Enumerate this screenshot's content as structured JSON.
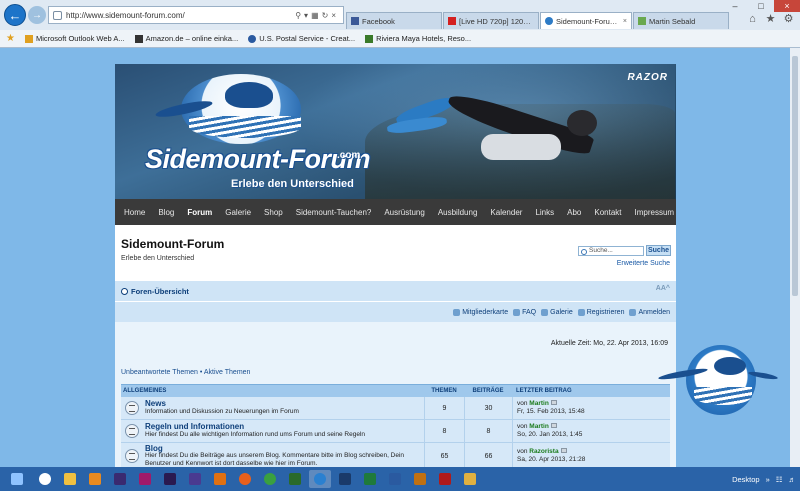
{
  "browser": {
    "address": "http://www.sidemount-forum.com/",
    "tabs": [
      {
        "label": "Facebook",
        "icon": "facebook-icon",
        "color": "#3b5998"
      },
      {
        "label": "[Live HD 720p] 120715 - P...",
        "icon": "youtube-icon",
        "color": "#d42020"
      },
      {
        "label": "Sidemount-Forum • F...",
        "icon": "site-icon",
        "color": "#2d7bc6",
        "active": true
      },
      {
        "label": "Martin Sebald",
        "icon": "page-icon",
        "color": "#6aa84f"
      }
    ],
    "favorites": [
      {
        "label": "Microsoft Outlook Web A...",
        "icon": "outlook-icon",
        "color": "#e0a020"
      },
      {
        "label": "Amazon.de – online einka...",
        "icon": "amazon-icon",
        "color": "#333333"
      },
      {
        "label": "U.S. Postal Service - Creat...",
        "icon": "usps-icon",
        "color": "#2a5aa0"
      },
      {
        "label": "Riviera Maya Hotels, Reso...",
        "icon": "palm-icon",
        "color": "#3a7a2a"
      }
    ]
  },
  "site": {
    "logo_text": "Sidemount-Forum",
    "logo_com": ".com",
    "logo_tagline": "Erlebe den Unterschied",
    "brand_mark": "RAZOR",
    "nav": [
      "Home",
      "Blog",
      "Forum",
      "Galerie",
      "Shop",
      "Sidemount-Tauchen?",
      "Ausrüstung",
      "Ausbildung",
      "Kalender",
      "Links",
      "Abo",
      "Kontakt",
      "Impressum"
    ],
    "nav_active": "Forum",
    "title": "Sidemount-Forum",
    "subtitle": "Erlebe den Unterschied",
    "search_placeholder": "Suche...",
    "search_button": "Suche",
    "advanced_search": "Erweiterte Suche",
    "breadcrumb": "Foren-Übersicht",
    "font_size_ctrl": "AA^",
    "links": [
      "Mitgliederkarte",
      "FAQ",
      "Galerie",
      "Registrieren",
      "Anmelden"
    ],
    "current_time": "Aktuelle Zeit: Mo, 22. Apr 2013, 16:09",
    "quick_links": "Unbeantwortete Themen • Aktive Themen",
    "table": {
      "headers": [
        "ALLGEMEINES",
        "THEMEN",
        "BEITRÄGE",
        "LETZTER BEITRAG"
      ],
      "rows": [
        {
          "name": "News",
          "desc": "Information und Diskussion zu Neuerungen im Forum",
          "topics": "9",
          "posts": "30",
          "last_by": "Martin",
          "last_date": "Fr, 15. Feb 2013, 15:48"
        },
        {
          "name": "Regeln und Informationen",
          "desc": "Hier findest Du alle wichtigen Information rund ums Forum und seine Regeln",
          "topics": "8",
          "posts": "8",
          "last_by": "Martin",
          "last_date": "So, 20. Jan 2013, 1:45"
        },
        {
          "name": "Blog",
          "desc": "Hier findest Du die Beiträge aus unserem Blog. Kommentare bitte im Blog schreiben, Dein Benutzer und Kennwort ist dort dasselbe wie hier im Forum.",
          "topics": "65",
          "posts": "66",
          "last_by": "Razorista",
          "last_date": "Sa, 20. Apr 2013, 21:28"
        }
      ]
    }
  },
  "taskbar": {
    "desktop_label": "Desktop",
    "apps": [
      {
        "name": "start",
        "color": "#2a63a8"
      },
      {
        "name": "hp",
        "color": "#ffffff"
      },
      {
        "name": "explorer",
        "color": "#f0c040"
      },
      {
        "name": "outlook",
        "color": "#e88a20"
      },
      {
        "name": "premiere",
        "color": "#3a2a70"
      },
      {
        "name": "indesign",
        "color": "#a01a6a"
      },
      {
        "name": "after-effects",
        "color": "#2a1a50"
      },
      {
        "name": "premiere-2",
        "color": "#4a3a90"
      },
      {
        "name": "vlc",
        "color": "#e07010"
      },
      {
        "name": "firefox",
        "color": "#e8601c"
      },
      {
        "name": "chrome",
        "color": "#3aa040"
      },
      {
        "name": "dreamweaver",
        "color": "#2a6a2a"
      },
      {
        "name": "ie",
        "color": "#2a80d0"
      },
      {
        "name": "photoshop",
        "color": "#1a3a6a"
      },
      {
        "name": "excel",
        "color": "#1f7a3a"
      },
      {
        "name": "word",
        "color": "#2a5aa0"
      },
      {
        "name": "illustrator",
        "color": "#c07010"
      },
      {
        "name": "acrobat",
        "color": "#b01a1a"
      },
      {
        "name": "folder",
        "color": "#e0b040"
      }
    ]
  }
}
